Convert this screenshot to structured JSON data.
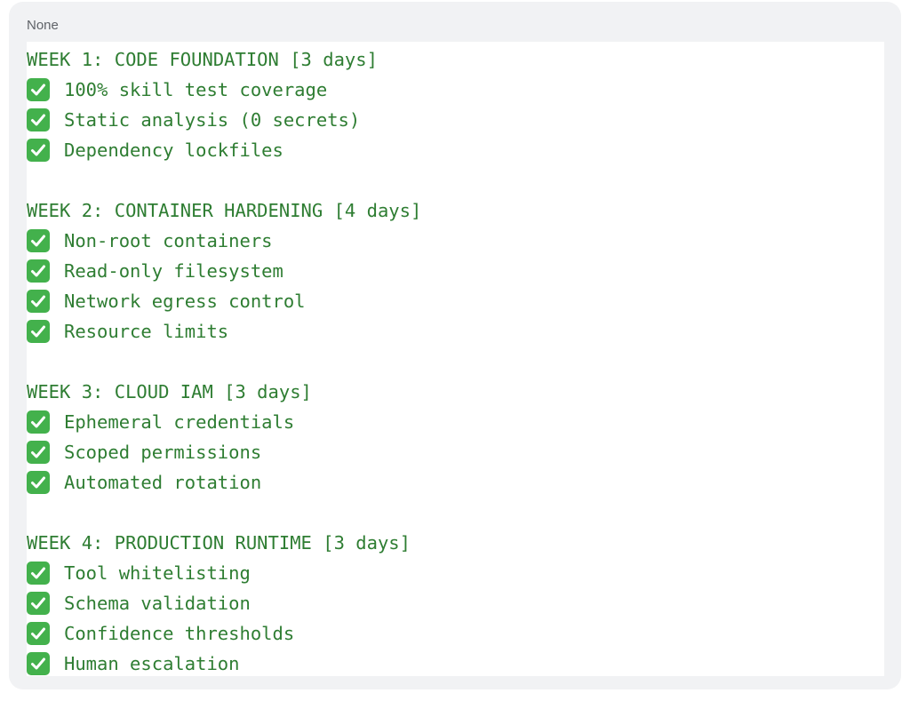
{
  "code_block": {
    "language": "None",
    "sections": [
      {
        "heading": "WEEK 1: CODE FOUNDATION [3 days]",
        "items": [
          "100% skill test coverage",
          "Static analysis (0 secrets)",
          "Dependency lockfiles"
        ]
      },
      {
        "heading": "WEEK 2: CONTAINER HARDENING [4 days]",
        "items": [
          "Non-root containers",
          "Read-only filesystem",
          "Network egress control",
          "Resource limits"
        ]
      },
      {
        "heading": "WEEK 3: CLOUD IAM [3 days]",
        "items": [
          "Ephemeral credentials",
          "Scoped permissions",
          "Automated rotation"
        ]
      },
      {
        "heading": "WEEK 4: PRODUCTION RUNTIME [3 days]",
        "items": [
          "Tool whitelisting",
          "Schema validation",
          "Confidence thresholds",
          "Human escalation"
        ]
      }
    ]
  },
  "colors": {
    "text": "#2e7d32",
    "check_bg": "#43b14c",
    "card_bg": "#f1f2f4"
  }
}
